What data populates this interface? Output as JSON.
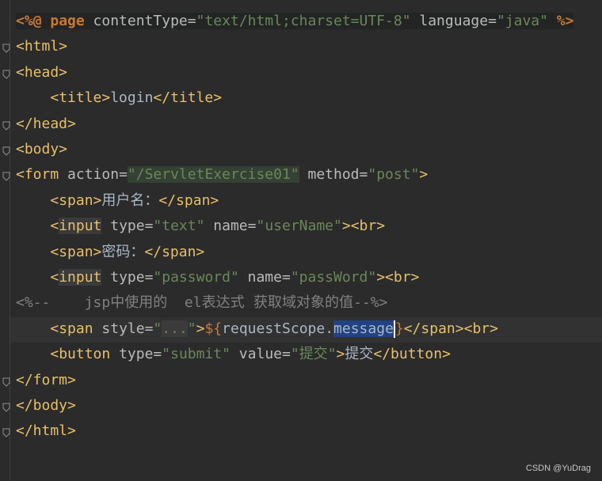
{
  "lines": [
    {
      "parts": [
        {
          "t": "<%@ ",
          "c": "jsp jspbg"
        },
        {
          "t": "page ",
          "c": "jsp jspbg"
        },
        {
          "t": "contentType",
          "c": "attr jspbg"
        },
        {
          "t": "=",
          "c": "attr jspbg"
        },
        {
          "t": "\"text/html;charset=UTF-8\"",
          "c": "str jspbg"
        },
        {
          "t": " language",
          "c": "attr jspbg"
        },
        {
          "t": "=",
          "c": "attr jspbg"
        },
        {
          "t": "\"java\"",
          "c": "str jspbg"
        },
        {
          "t": " %>",
          "c": "jsp jspbg"
        }
      ]
    },
    {
      "parts": [
        {
          "t": "<html>",
          "c": "t"
        }
      ]
    },
    {
      "parts": [
        {
          "t": "<head>",
          "c": "t"
        }
      ]
    },
    {
      "parts": [
        {
          "t": "    "
        },
        {
          "t": "<title>",
          "c": "t"
        },
        {
          "t": "login",
          "c": "txt"
        },
        {
          "t": "</title>",
          "c": "t"
        }
      ]
    },
    {
      "parts": [
        {
          "t": "</head>",
          "c": "t"
        }
      ]
    },
    {
      "parts": [
        {
          "t": "<body>",
          "c": "t"
        }
      ]
    },
    {
      "parts": [
        {
          "t": "<form ",
          "c": "t"
        },
        {
          "t": "action",
          "c": "attr"
        },
        {
          "t": "=",
          "c": "attr"
        },
        {
          "t": "\"/ServletExercise01\"",
          "c": "str hl-str"
        },
        {
          "t": " method",
          "c": "attr"
        },
        {
          "t": "=",
          "c": "attr"
        },
        {
          "t": "\"post\"",
          "c": "str"
        },
        {
          "t": ">",
          "c": "t"
        }
      ]
    },
    {
      "parts": [
        {
          "t": "    "
        },
        {
          "t": "<span>",
          "c": "t"
        },
        {
          "t": "用户名：",
          "c": "txt cjk"
        },
        {
          "t": "</span>",
          "c": "t"
        }
      ]
    },
    {
      "parts": [
        {
          "t": "    "
        },
        {
          "t": "<",
          "c": "t"
        },
        {
          "t": "input",
          "c": "t hl-tag"
        },
        {
          "t": " type",
          "c": "attr"
        },
        {
          "t": "=",
          "c": "attr"
        },
        {
          "t": "\"text\"",
          "c": "str"
        },
        {
          "t": " name",
          "c": "attr"
        },
        {
          "t": "=",
          "c": "attr"
        },
        {
          "t": "\"userName\"",
          "c": "str"
        },
        {
          "t": "><br>",
          "c": "t"
        }
      ]
    },
    {
      "parts": [
        {
          "t": "    "
        },
        {
          "t": "<span>",
          "c": "t"
        },
        {
          "t": "密码：",
          "c": "txt cjk"
        },
        {
          "t": "</span>",
          "c": "t"
        }
      ]
    },
    {
      "parts": [
        {
          "t": "    "
        },
        {
          "t": "<",
          "c": "t"
        },
        {
          "t": "input",
          "c": "t hl-tag"
        },
        {
          "t": " type",
          "c": "attr"
        },
        {
          "t": "=",
          "c": "attr"
        },
        {
          "t": "\"password\"",
          "c": "str"
        },
        {
          "t": " name",
          "c": "attr"
        },
        {
          "t": "=",
          "c": "attr"
        },
        {
          "t": "\"passWord\"",
          "c": "str"
        },
        {
          "t": "><br>",
          "c": "t"
        }
      ]
    },
    {
      "parts": [
        {
          "t": "<%--    jsp",
          "c": "cmt"
        },
        {
          "t": "中使用的",
          "c": "cmt cjk"
        },
        {
          "t": "  el",
          "c": "cmt"
        },
        {
          "t": "表达式  获取域对象的值",
          "c": "cmt cjk"
        },
        {
          "t": "--%>",
          "c": "cmt"
        }
      ]
    },
    {
      "parts": [
        {
          "t": "    "
        },
        {
          "t": "<span ",
          "c": "t"
        },
        {
          "t": "style",
          "c": "attr"
        },
        {
          "t": "=",
          "c": "attr"
        },
        {
          "t": "\"",
          "c": "str"
        },
        {
          "t": "...",
          "c": "str hl-tag"
        },
        {
          "t": "\"",
          "c": "str"
        },
        {
          "t": ">",
          "c": "t"
        },
        {
          "t": "${",
          "c": "el"
        },
        {
          "t": "requestScope.",
          "c": "txt"
        },
        {
          "t": "message",
          "c": "txt hl-sel"
        },
        {
          "caret": true
        },
        {
          "t": "}",
          "c": "el"
        },
        {
          "t": "</span><br>",
          "c": "t"
        }
      ]
    },
    {
      "parts": [
        {
          "t": "    "
        },
        {
          "t": "<button ",
          "c": "t"
        },
        {
          "t": "type",
          "c": "attr"
        },
        {
          "t": "=",
          "c": "attr"
        },
        {
          "t": "\"submit\"",
          "c": "str"
        },
        {
          "t": " value",
          "c": "attr"
        },
        {
          "t": "=",
          "c": "attr"
        },
        {
          "t": "\"",
          "c": "str"
        },
        {
          "t": "提交",
          "c": "str cjk"
        },
        {
          "t": "\"",
          "c": "str"
        },
        {
          "t": ">",
          "c": "t"
        },
        {
          "t": "提交",
          "c": "txt cjk"
        },
        {
          "t": "</button>",
          "c": "t"
        }
      ]
    },
    {
      "parts": [
        {
          "t": "</form>",
          "c": "t"
        }
      ]
    },
    {
      "parts": [
        {
          "t": "</body>",
          "c": "t"
        }
      ]
    },
    {
      "parts": [
        {
          "t": "</html>",
          "c": "t"
        }
      ]
    }
  ],
  "watermark": "CSDN @YuDrag"
}
